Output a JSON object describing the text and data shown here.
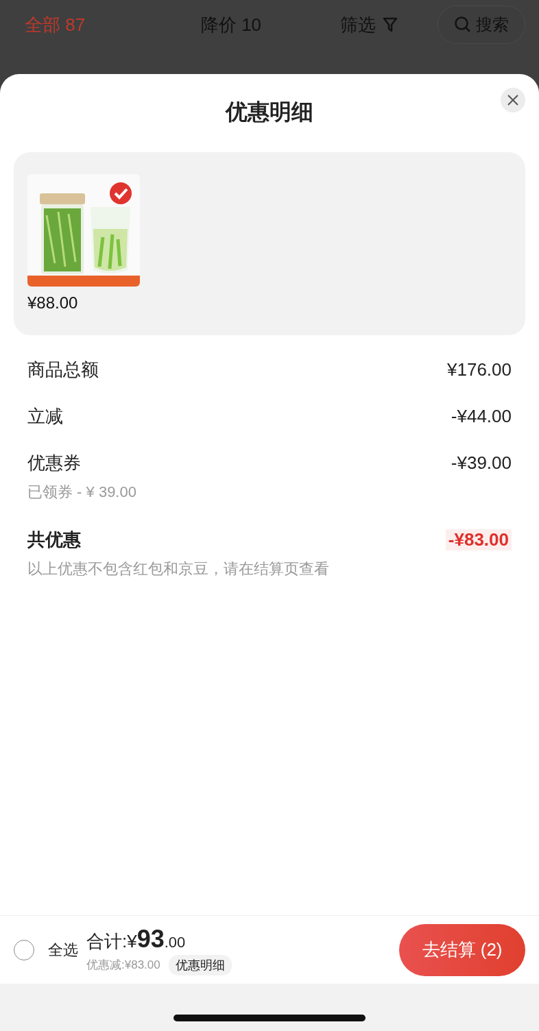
{
  "tabs": [
    {
      "label": "全部 87",
      "selected": true,
      "kind": "text"
    },
    {
      "label": "降价 10",
      "selected": false,
      "kind": "text"
    },
    {
      "label": "筛选",
      "selected": false,
      "kind": "filter"
    }
  ],
  "search_button": "搜索",
  "sheet": {
    "title": "优惠明细",
    "product": {
      "price": "¥88.00"
    },
    "lines": [
      {
        "label": "商品总额",
        "value": "¥176.00",
        "kind": "normal"
      },
      {
        "label": "立减",
        "value": "-¥44.00",
        "kind": "normal"
      },
      {
        "label": "优惠券",
        "value": "-¥39.00",
        "note": "已领券 - ¥ 39.00",
        "kind": "normal"
      },
      {
        "label": "共优惠",
        "value": "-¥83.00",
        "note": "以上优惠不包含红包和京豆，请在结算页查看",
        "kind": "total"
      }
    ]
  },
  "bottom_bar": {
    "select_all": {
      "label": "全选",
      "checked": false
    },
    "total_prefix": "合计:¥",
    "total_integer": "93",
    "total_decimal": ".00",
    "discount": "优惠减:¥83.00",
    "detail_button": "优惠明细",
    "checkout_button": "去结算 (2)"
  }
}
